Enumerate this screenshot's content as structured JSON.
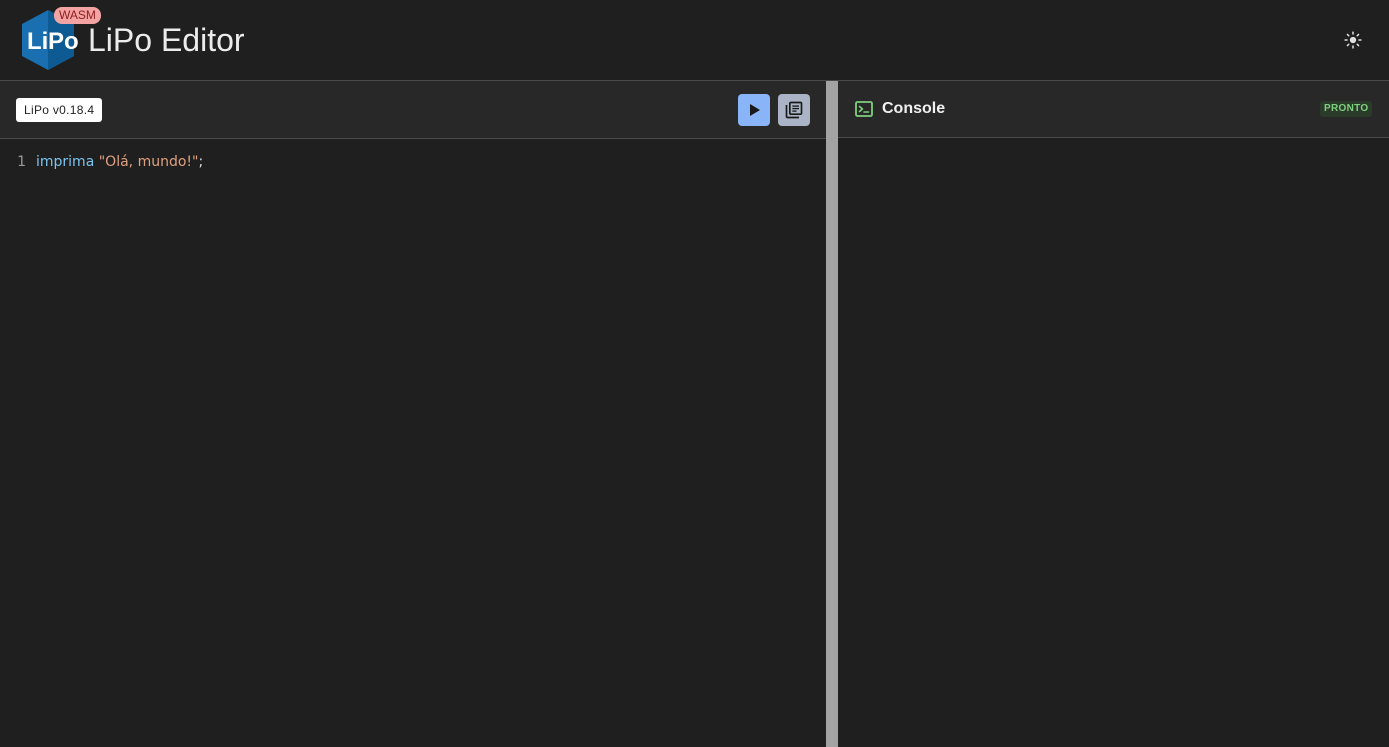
{
  "header": {
    "title": "LiPo Editor",
    "badge": "WASM",
    "logo_icon": "lipo-logo",
    "theme_toggle_icon": "sun-icon"
  },
  "editor": {
    "version_chip": "LiPo v0.18.4",
    "run_icon": "play-icon",
    "docs_icon": "library-books-icon",
    "lines": [
      {
        "number": "1",
        "keyword": "imprima",
        "string": "\"Olá, mundo!\"",
        "punct": ";"
      }
    ]
  },
  "console": {
    "title": "Console",
    "status": "PRONTO",
    "icon": "terminal-icon",
    "output": ""
  },
  "colors": {
    "background": "#1f1f1f",
    "toolbar": "#282828",
    "accent_run": "#8ab4f8",
    "keyword": "#7cc4f0",
    "string": "#e0a080",
    "status_ok": "#7fd17f",
    "badge": "#f4a3a3"
  }
}
